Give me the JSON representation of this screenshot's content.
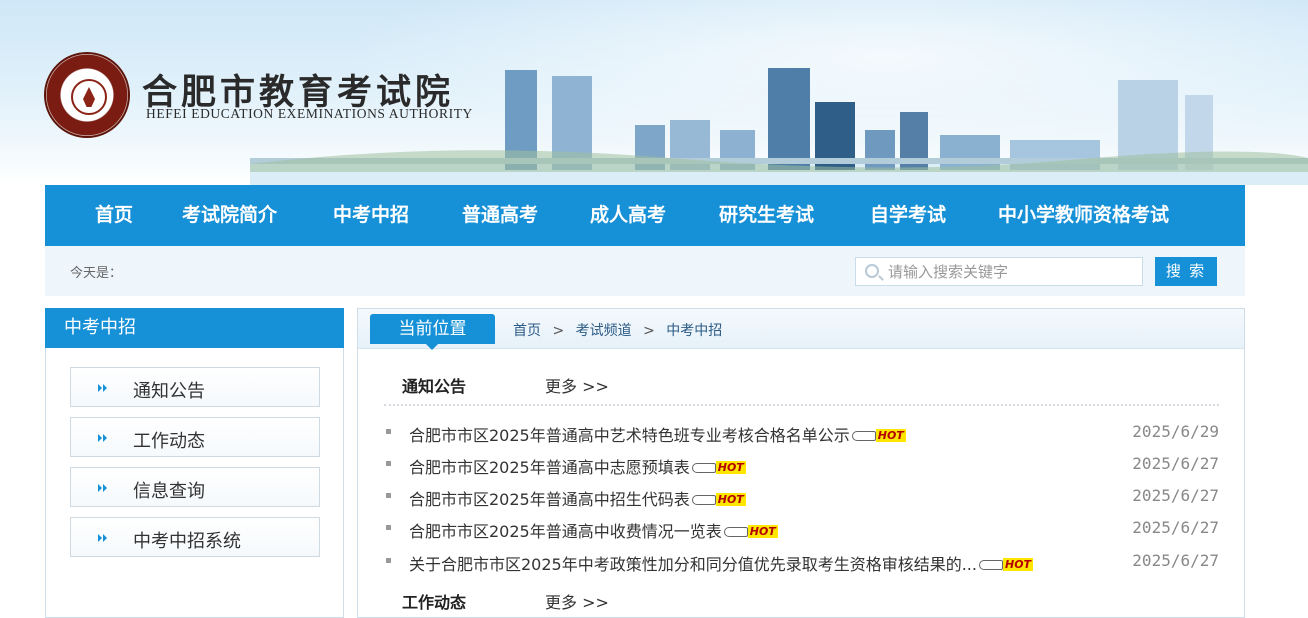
{
  "header": {
    "title": "合肥市教育考试院",
    "subtitle": "HEFEI EDUCATION EXEMINATIONS AUTHORITY"
  },
  "nav": {
    "items": [
      "首页",
      "考试院简介",
      "中考中招",
      "普通高考",
      "成人高考",
      "研究生考试",
      "自学考试",
      "中小学教师资格考试"
    ]
  },
  "subbar": {
    "today_label": "今天是：",
    "search_placeholder": "请输入搜索关键字",
    "search_button": "搜 索"
  },
  "sidebar": {
    "title": "中考中招",
    "items": [
      "通知公告",
      "工作动态",
      "信息查询",
      "中考中招系统"
    ]
  },
  "main": {
    "position_label": "当前位置",
    "breadcrumb": [
      "首页",
      "考试频道",
      "中考中招"
    ],
    "breadcrumb_sep": ">",
    "sections": [
      {
        "title": "通知公告",
        "more": "更多 >>",
        "items": [
          {
            "title": "合肥市市区2025年普通高中艺术特色班专业考核合格名单公示",
            "date": "2025/6/29",
            "hot": "HOT"
          },
          {
            "title": "合肥市市区2025年普通高中志愿预填表",
            "date": "2025/6/27",
            "hot": "HOT"
          },
          {
            "title": "合肥市市区2025年普通高中招生代码表",
            "date": "2025/6/27",
            "hot": "HOT"
          },
          {
            "title": "合肥市市区2025年普通高中收费情况一览表",
            "date": "2025/6/27",
            "hot": "HOT"
          },
          {
            "title": "关于合肥市市区2025年中考政策性加分和同分值优先录取考生资格审核结果的...",
            "date": "2025/6/27",
            "hot": "HOT"
          }
        ]
      },
      {
        "title": "工作动态",
        "more": "更多 >>"
      }
    ]
  },
  "colors": {
    "primary": "#1690d6",
    "hot_bg": "#ffe600",
    "logo": "#7a1c12"
  }
}
